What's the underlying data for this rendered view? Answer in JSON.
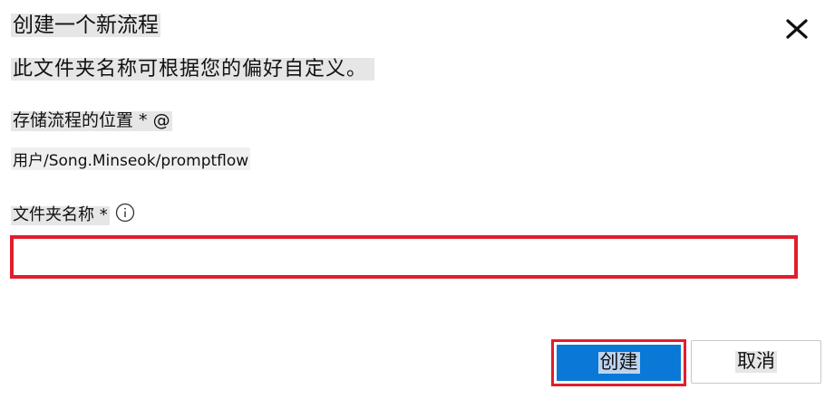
{
  "dialog": {
    "title": "创建一个新流程",
    "subtitle": "此文件夹名称可根据您的偏好自定义。",
    "close_icon": "close-icon"
  },
  "location": {
    "label": "存储流程的位置 * @",
    "value": "用户/Song.Minseok/promptflow"
  },
  "folder_name": {
    "label": "文件夹名称 *",
    "info_icon": "info-icon",
    "value": "",
    "placeholder": "",
    "highlight_color": "#e01e2d"
  },
  "actions": {
    "create_label": "创建",
    "cancel_label": "取消",
    "create_color": "#0a78d7"
  }
}
